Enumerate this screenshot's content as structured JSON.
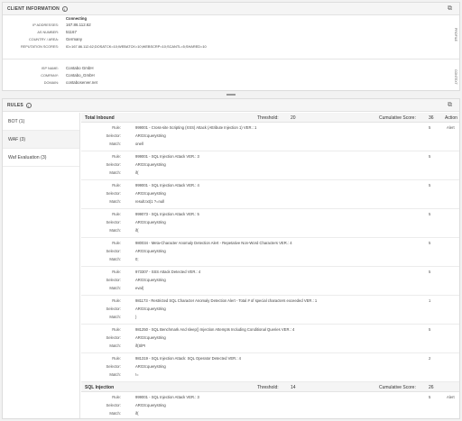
{
  "client_info": {
    "title": "CLIENT INFORMATION",
    "status": "Connecting",
    "fields": [
      {
        "label": "IP ADDRESSES:",
        "value": "167.86.112.62"
      },
      {
        "label": "AS NUMBER:",
        "value": "51167"
      },
      {
        "label": "COUNTRY / AREA:",
        "value": "Germany"
      },
      {
        "label": "REPUTATION SCORES:",
        "value": "ID=167.86.112.62;DOSATCK=10;WEBATCK=10;WEBSCRP=10;SCANTL=5;SHARED=10"
      }
    ],
    "fields2": [
      {
        "label": "ISP NAME:",
        "value": "Contabo GmbH"
      },
      {
        "label": "COMPANY:",
        "value": "Contabo_GmbH"
      },
      {
        "label": "DOMAIN:",
        "value": "contaboserver.net"
      }
    ],
    "side1": "PROFILE",
    "side2": "CONTEXT"
  },
  "rules": {
    "title": "RULES",
    "tabs": [
      {
        "label": "BOT (1)"
      },
      {
        "label": "WAF (3)"
      },
      {
        "label": "Waf Evaluation (3)"
      }
    ],
    "groups": [
      {
        "name": "Total Inbound",
        "threshold_label": "Threshold:",
        "threshold": "20",
        "cumulative_label": "Cumulative Score:",
        "cumulative": "36",
        "action_header": "Action",
        "action": "Alert",
        "entries": [
          {
            "rule": "999001 - Cross-site Scripting (XSS) Attack (Attribute Injection 1) VER.: 1",
            "selector": "ARGS:querystring",
            "match": "onell",
            "score": "5"
          },
          {
            "rule": "999001 - SQL Injection Attack VER.: 3",
            "selector": "ARGS:querystring",
            "match": "if(",
            "score": "5"
          },
          {
            "rule": "999001 - SQL Injection Attack VER.: 4",
            "selector": "ARGS:querystring",
            "match": "result.txt(1 ?=null",
            "score": "5"
          },
          {
            "rule": "999073 - SQL Injection Attack VER.: 5",
            "selector": "ARGS:querystring",
            "match": "if(",
            "score": "5"
          },
          {
            "rule": "980034 - Meta-Character Anomaly Detection Alert - Repetative Non-Word Characters VER.: 4",
            "selector": "ARGS:querystring",
            "match": "0;",
            "score": "5"
          },
          {
            "rule": "973307 - SSS Attack Detected VER.: 4",
            "selector": "ARGS:querystring",
            "match": "eval(",
            "score": "5"
          },
          {
            "rule": "981173 - Restricted SQL Character Anomaly Detection Alert - Total # of special characters exceeded VER.: 1",
            "selector": "ARGS:querystring",
            "match": ")",
            "score": "1"
          },
          {
            "rule": "981250 - SQL Benchmark And sleep() Injection Attempts Including Conditional Queries VER.: 4",
            "selector": "ARGS:querystring",
            "match": "if(SlPI",
            "score": "5"
          },
          {
            "rule": "981319 - SQL Injection Attack: SQL Operator Detected VER.: 4",
            "selector": "ARGS:querystring",
            "match": "!=",
            "score": "2"
          }
        ]
      },
      {
        "name": "SQL Injection",
        "threshold_label": "Threshold:",
        "threshold": "14",
        "cumulative_label": "Cumulative Score:",
        "cumulative": "26",
        "action": "Alert",
        "entries": [
          {
            "rule": "999001 - SQL Injection Attack VER.: 3",
            "selector": "ARGS:querystring",
            "match": "if(",
            "score": "5"
          }
        ]
      }
    ],
    "labels": {
      "rule": "Rule:",
      "selector": "Selector:",
      "match": "Match:"
    }
  }
}
